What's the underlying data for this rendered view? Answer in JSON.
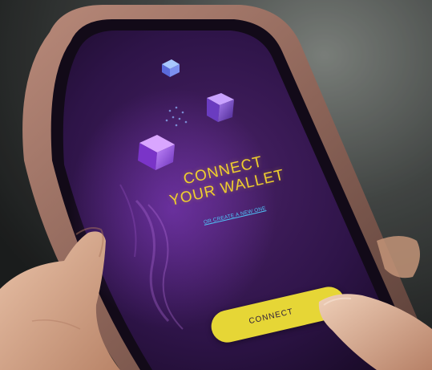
{
  "wallet_screen": {
    "heading_line1": "CONNECT",
    "heading_line2": "YOUR WALLET",
    "create_link": "OR CREATE A NEW ONE",
    "connect_button": "CONNECT"
  },
  "colors": {
    "accent_yellow": "#e6d636",
    "heading_yellow": "#f0cf2e",
    "link_blue": "#4fc3f7",
    "screen_purple": "#3a1a5a"
  }
}
